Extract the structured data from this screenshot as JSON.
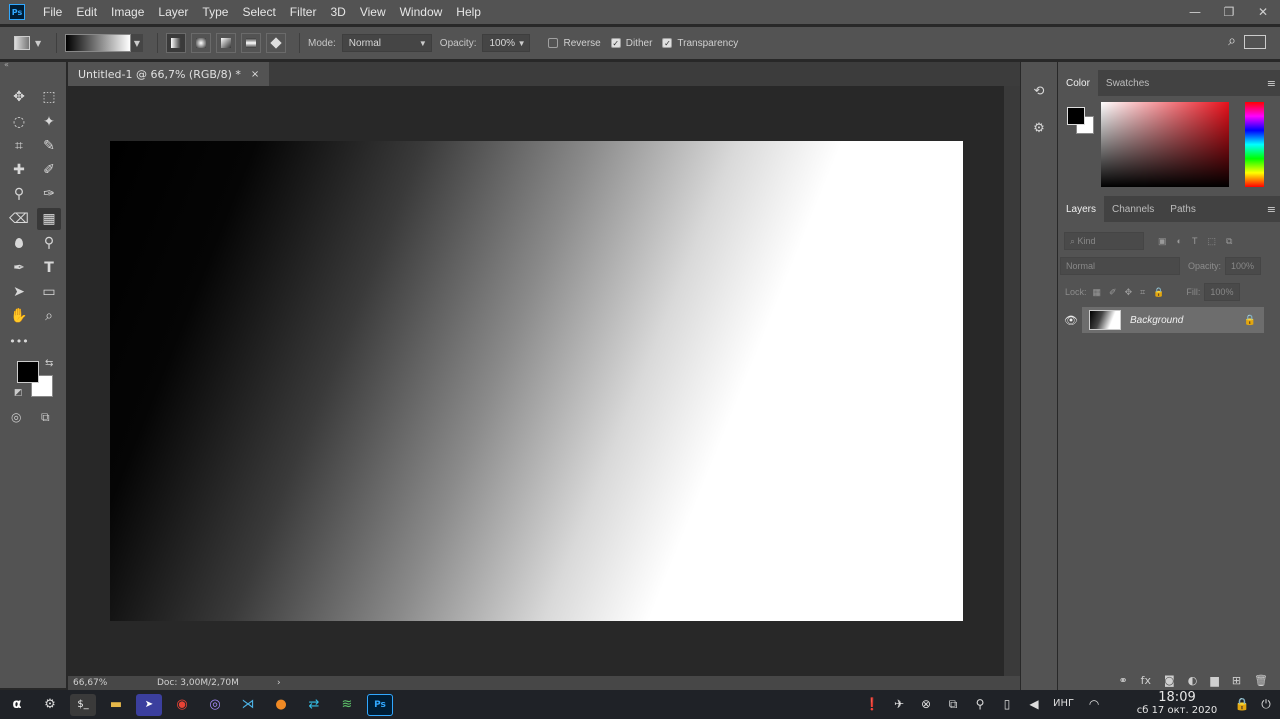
{
  "app": {
    "logo": "Ps",
    "menu": [
      "File",
      "Edit",
      "Image",
      "Layer",
      "Type",
      "Select",
      "Filter",
      "3D",
      "View",
      "Window",
      "Help"
    ]
  },
  "window_controls": {
    "minimize": "—",
    "restore": "❐",
    "close": "✕"
  },
  "options": {
    "mode_label": "Mode:",
    "mode_value": "Normal",
    "opacity_label": "Opacity:",
    "opacity_value": "100%",
    "reverse_label": "Reverse",
    "reverse_checked": false,
    "dither_label": "Dither",
    "dither_checked": true,
    "transparency_label": "Transparency",
    "transparency_checked": true
  },
  "document": {
    "tab_title": "Untitled-1 @ 66,7% (RGB/8) *",
    "tab_close": "×",
    "zoom": "66,67%",
    "doc_size": "Doc: 3,00M/2,70M",
    "status_arrow": "›"
  },
  "toolbar": {
    "collapse": "«",
    "tools": [
      {
        "name": "move-tool-icon",
        "glyph": "✥"
      },
      {
        "name": "marquee-tool-icon",
        "glyph": "⬚"
      },
      {
        "name": "lasso-tool-icon",
        "glyph": "◌"
      },
      {
        "name": "magic-wand-tool-icon",
        "glyph": "✦"
      },
      {
        "name": "crop-tool-icon",
        "glyph": "⌗"
      },
      {
        "name": "eyedropper-tool-icon",
        "glyph": "✎"
      },
      {
        "name": "healing-brush-tool-icon",
        "glyph": "✚"
      },
      {
        "name": "brush-tool-icon",
        "glyph": "✐"
      },
      {
        "name": "clone-stamp-tool-icon",
        "glyph": "⚲"
      },
      {
        "name": "history-brush-tool-icon",
        "glyph": "✑"
      },
      {
        "name": "eraser-tool-icon",
        "glyph": "⌫"
      },
      {
        "name": "gradient-tool-icon",
        "glyph": "▦"
      },
      {
        "name": "blur-tool-icon",
        "glyph": "💧"
      },
      {
        "name": "dodge-tool-icon",
        "glyph": "⚲"
      },
      {
        "name": "pen-tool-icon",
        "glyph": "✒"
      },
      {
        "name": "type-tool-icon",
        "glyph": "T"
      },
      {
        "name": "path-selection-tool-icon",
        "glyph": "➤"
      },
      {
        "name": "rectangle-tool-icon",
        "glyph": "▭"
      },
      {
        "name": "hand-tool-icon",
        "glyph": "✋"
      },
      {
        "name": "zoom-tool-icon",
        "glyph": "⌕"
      },
      {
        "name": "more-tools-icon",
        "glyph": "•••"
      }
    ],
    "swap_glyph": "⇆",
    "reset_glyph": "◩",
    "quick_mask_glyph": "◎",
    "screen_mode_glyph": "⧉"
  },
  "color_panel": {
    "tabs": [
      "Color",
      "Swatches"
    ],
    "active_tab": "Color",
    "foreground": "#000000",
    "background": "#ffffff",
    "menu_glyph": "≡"
  },
  "layers_panel": {
    "tabs": [
      "Layers",
      "Channels",
      "Paths"
    ],
    "active_tab": "Layers",
    "filter_placeholder": "⌕ Kind",
    "blend_mode": "Normal",
    "opacity_label": "Opacity:",
    "opacity_value": "100%",
    "lock_label": "Lock:",
    "fill_label": "Fill:",
    "fill_value": "100%",
    "menu_glyph": "≡",
    "layers": [
      {
        "name": "Background",
        "visible": true,
        "locked": true
      }
    ],
    "footer_icons": [
      "⚭",
      "fx",
      "◙",
      "◐",
      "▆",
      "⊞",
      "🗑"
    ]
  },
  "taskbar": {
    "clock_time": "18:09",
    "clock_date": "сб 17 окт. 2020",
    "language": "ИНГ"
  },
  "colors": {
    "chrome": "#535353",
    "document_bg": "#282828",
    "panel_tabs": "#424242",
    "taskbar": "#1f2227",
    "ps_accent": "#31a8ff"
  }
}
